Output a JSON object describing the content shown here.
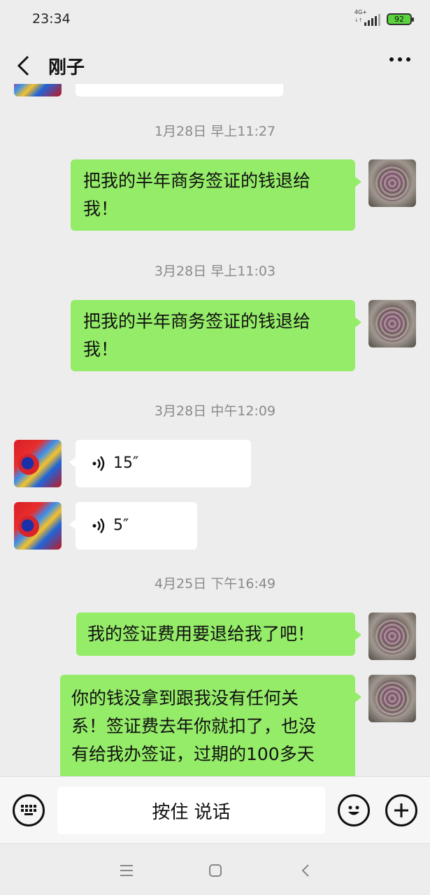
{
  "status_bar": {
    "time": "23:34",
    "network": "4G+",
    "network_sub": "↓↑",
    "battery": "92"
  },
  "header": {
    "title": "刚子",
    "back_icon": "back-chevron-icon",
    "more_icon": "more-dots-icon"
  },
  "messages": [
    {
      "type": "timestamp",
      "text": "1月28日 早上11:27"
    },
    {
      "type": "text",
      "direction": "out",
      "lines": [
        "把我的半年商务签证的钱退给",
        "我！"
      ]
    },
    {
      "type": "timestamp",
      "text": "3月28日 早上11:03"
    },
    {
      "type": "text",
      "direction": "out",
      "lines": [
        "把我的半年商务签证的钱退给",
        "我！"
      ]
    },
    {
      "type": "timestamp",
      "text": "3月28日 中午12:09"
    },
    {
      "type": "voice",
      "direction": "in",
      "duration": "15″"
    },
    {
      "type": "voice",
      "direction": "in",
      "duration": "5″"
    },
    {
      "type": "timestamp",
      "text": "4月25日 下午16:49"
    },
    {
      "type": "text",
      "direction": "out",
      "lines": [
        "我的签证费用要退给我了吧！"
      ]
    },
    {
      "type": "text",
      "direction": "out",
      "lines": [
        "你的钱没拿到跟我没有任何关",
        "系！签证费去年你就扣了，也没",
        "有给我办签证，过期的100多天"
      ]
    }
  ],
  "input_bar": {
    "talk_label": "按住 说话",
    "keyboard_icon": "keyboard-icon",
    "emoji_icon": "emoji-icon",
    "plus_icon": "plus-icon"
  },
  "nav_bar": {
    "menu_icon": "menu-icon",
    "home_icon": "home-icon",
    "back_icon": "nav-back-icon"
  }
}
